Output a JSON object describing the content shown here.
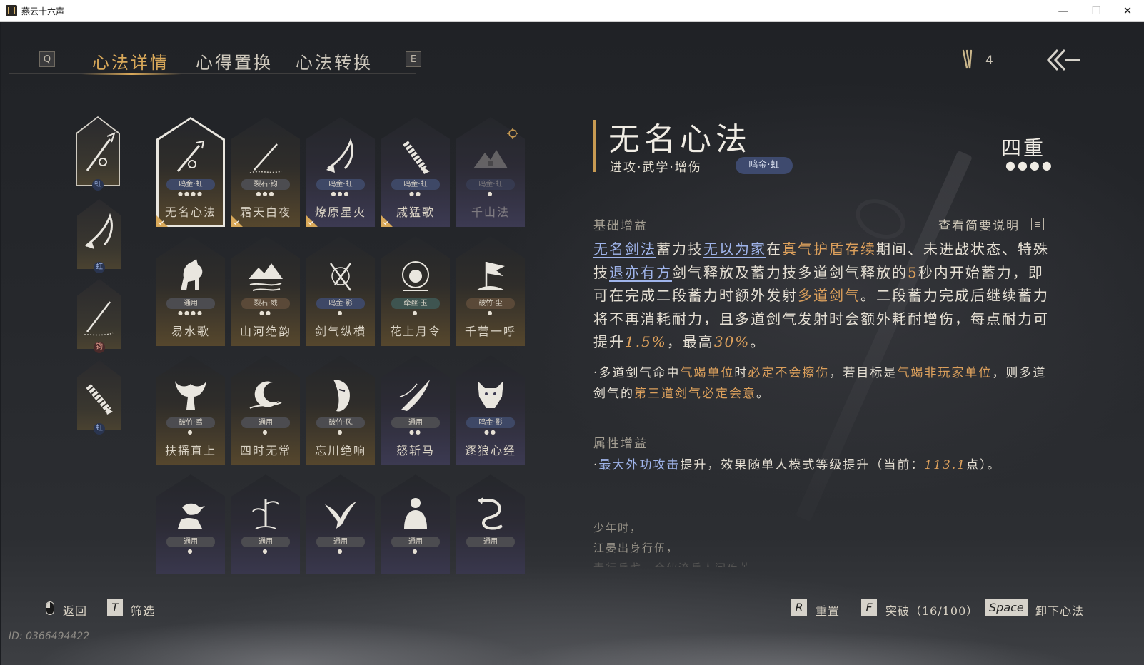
{
  "window": {
    "title": "燕云十六声",
    "min": "—",
    "max": "☐",
    "close": "✕"
  },
  "tabs": {
    "left_key": "Q",
    "right_key": "E",
    "items": [
      {
        "label": "心法详情",
        "active": true
      },
      {
        "label": "心得置换",
        "active": false
      },
      {
        "label": "心法转换",
        "active": false
      }
    ]
  },
  "top_right": {
    "points_count": "4"
  },
  "equipped_slots": [
    {
      "badge": "虹",
      "badge_type": "blue",
      "selected": true,
      "icon": "sword-icon"
    },
    {
      "badge": "虹",
      "badge_type": "blue",
      "selected": false,
      "icon": "scythe-icon"
    },
    {
      "badge": "钧",
      "badge_type": "red",
      "selected": false,
      "icon": "spear-icon"
    },
    {
      "badge": "虹",
      "badge_type": "blue",
      "selected": false,
      "icon": "bracer-icon"
    }
  ],
  "cards": [
    {
      "name": "无名心法",
      "tag": "鸣金·虹",
      "tag_color": "blue",
      "dots": "●●●●",
      "style": "gold",
      "selected": true,
      "check": true,
      "icon": "sword-icon"
    },
    {
      "name": "霜天白夜",
      "tag": "裂石·钧",
      "tag_color": "grey",
      "dots": "●●●",
      "style": "gold",
      "check": true,
      "icon": "spear-icon"
    },
    {
      "name": "燎原星火",
      "tag": "鸣金·虹",
      "tag_color": "blue",
      "dots": "●●●",
      "style": "purple",
      "check": true,
      "icon": "scythe-icon"
    },
    {
      "name": "戚猛歌",
      "tag": "鸣金·虹",
      "tag_color": "blue",
      "dots": "●●",
      "style": "purple",
      "check": true,
      "icon": "bracer-icon"
    },
    {
      "name": "千山法",
      "tag": "鸣金·虹",
      "tag_color": "blue",
      "dots": "●",
      "style": "purple",
      "dim": true,
      "icon": "mountain-icon"
    },
    {
      "name": "易水歌",
      "tag": "通用",
      "tag_color": "grey",
      "dots": "●●●●",
      "style": "gold",
      "icon": "horse-icon"
    },
    {
      "name": "山河绝韵",
      "tag": "裂石·威",
      "tag_color": "brown",
      "dots": "●●",
      "style": "gold",
      "icon": "landscape-icon"
    },
    {
      "name": "剑气纵横",
      "tag": "鸣金·影",
      "tag_color": "blue",
      "dots": "●",
      "style": "gold",
      "icon": "swords-icon"
    },
    {
      "name": "花上月令",
      "tag": "牵丝·玉",
      "tag_color": "teal",
      "dots": "●",
      "style": "gold",
      "icon": "flower-icon"
    },
    {
      "name": "千营一呼",
      "tag": "破竹·尘",
      "tag_color": "brown",
      "dots": "●",
      "style": "gold",
      "icon": "flag-icon"
    },
    {
      "name": "扶摇直上",
      "tag": "破竹·鸢",
      "tag_color": "grey",
      "dots": "●",
      "style": "gold",
      "icon": "eagle-icon"
    },
    {
      "name": "四时无常",
      "tag": "通用",
      "tag_color": "grey",
      "dots": "●",
      "style": "gold",
      "icon": "moon-icon"
    },
    {
      "name": "忘川绝响",
      "tag": "破竹·风",
      "tag_color": "grey",
      "dots": "●",
      "style": "gold",
      "icon": "mask-icon"
    },
    {
      "name": "怒斩马",
      "tag": "通用",
      "tag_color": "grey",
      "dots": "●●",
      "style": "purple",
      "icon": "blade-icon"
    },
    {
      "name": "逐狼心经",
      "tag": "鸣金·影",
      "tag_color": "blue",
      "dots": "●●",
      "style": "purple",
      "icon": "wolf-icon"
    },
    {
      "name": "",
      "tag": "通用",
      "tag_color": "grey",
      "dots": "●",
      "style": "purple",
      "icon": "bird-hand-icon"
    },
    {
      "name": "",
      "tag": "通用",
      "tag_color": "grey",
      "dots": "●",
      "style": "purple",
      "icon": "bamboo-icon"
    },
    {
      "name": "",
      "tag": "通用",
      "tag_color": "grey",
      "dots": "●",
      "style": "purple",
      "icon": "swallow-icon"
    },
    {
      "name": "",
      "tag": "通用",
      "tag_color": "grey",
      "dots": "●",
      "style": "purple",
      "icon": "buddha-icon"
    },
    {
      "name": "",
      "tag": "通用",
      "tag_color": "grey",
      "dots": "",
      "style": "purple",
      "icon": "dragon-icon"
    }
  ],
  "detail": {
    "title": "无名心法",
    "subtitle": "进攻·武学·增伤",
    "tag": "鸣金·虹",
    "tier": "四重",
    "tier_dots": "●●●●",
    "section_base": "基础增益",
    "help_label": "查看简要说明",
    "para1": {
      "s1": "无名剑法",
      "s2": "蓄力技",
      "s3": "无以为家",
      "s4": "在",
      "s5": "真气护盾存续",
      "s6": "期间、未进战状态、特殊技",
      "s7": "退亦有方",
      "s8": "剑气释放及蓄力技多道剑气释放的",
      "s9": "5",
      "s10": "秒内开始蓄力，即可在完成二段蓄力时额外发射",
      "s11": "多道剑气",
      "s12": "。二段蓄力完成后继续蓄力将不再消耗耐力，且多道剑气发射时会额外耗耐增伤，每点耐力可提升",
      "s13": "1.5%",
      "s14": "，最高",
      "s15": "30%",
      "s16": "。"
    },
    "para2": {
      "s1": "·多道剑气命中",
      "s2": "气竭单位",
      "s3": "时",
      "s4": "必定不会擦伤",
      "s5": "，若目标是",
      "s6": "气竭非玩家单位",
      "s7": "，则多道剑气的",
      "s8": "第三道剑气必定会意",
      "s9": "。"
    },
    "section_attr": "属性增益",
    "para3": {
      "s1": "·",
      "s2": "最大外功攻击",
      "s3": "提升，效果随单人模式等级提升（当前：",
      "s4": "113.1",
      "s5": "点）。"
    },
    "lore": [
      "少年时，",
      "江晏出身行伍，",
      "素行兵戈，合伙流兵人间疾苦，"
    ]
  },
  "footer": {
    "back_label": "返回",
    "filter_key": "T",
    "filter_label": "筛选",
    "reset_key": "R",
    "reset_label": "重置",
    "break_key": "F",
    "break_label": "突破（16/100）",
    "unequip_key": "Space",
    "unequip_label": "卸下心法",
    "uid": "ID: 0366494422"
  },
  "colors": {
    "accent_gold": "#d9a95a",
    "link_blue": "#9fb4ea",
    "highlight_orange": "#dca05c"
  }
}
